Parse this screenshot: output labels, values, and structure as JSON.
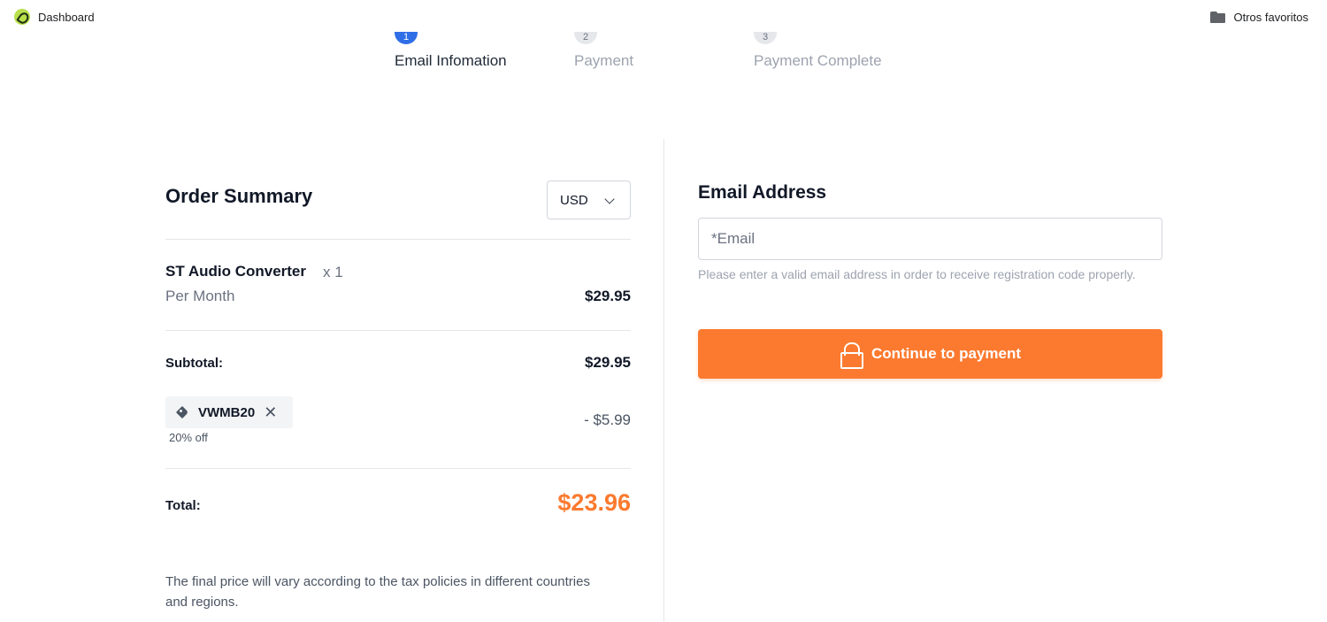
{
  "bookmarks": {
    "left_label": "Dashboard",
    "right_label": "Otros favoritos"
  },
  "stepper": {
    "steps": [
      {
        "label": "Email Infomation",
        "number": "1",
        "state": "active"
      },
      {
        "label": "Payment",
        "number": "2",
        "state": "pending"
      },
      {
        "label": "Payment Complete",
        "number": "3",
        "state": "pending"
      }
    ]
  },
  "order": {
    "title": "Order Summary",
    "currency": "USD",
    "product": {
      "name": "ST Audio Converter",
      "qty": "x 1",
      "period": "Per Month",
      "price": "$29.95"
    },
    "subtotal_label": "Subtotal:",
    "subtotal_value": "$29.95",
    "coupon": {
      "code": "VWMB20",
      "off": "20% off",
      "discount": "- $5.99"
    },
    "total_label": "Total:",
    "total_value": "$23.96",
    "tax_note": "The final price will vary according to the tax policies in different countries and regions."
  },
  "email": {
    "title": "Email Address",
    "placeholder": "*Email",
    "value": "",
    "help": "Please enter a valid email address in order to receive registration code properly.",
    "button_label": "Continue to payment"
  },
  "colors": {
    "accent": "#fb7a2f",
    "step_active": "#2f6ee6"
  }
}
